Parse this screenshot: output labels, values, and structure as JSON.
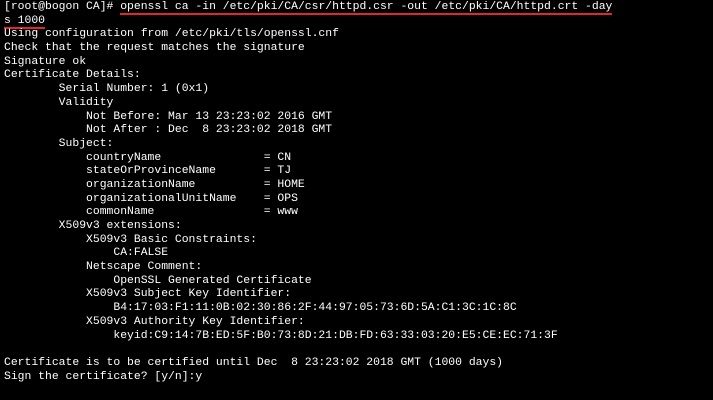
{
  "theme": {
    "background": "#000000",
    "foreground": "#ffffff",
    "highlight_underline": "#e3262c"
  },
  "prompt": "[root@bogon CA]# ",
  "command_part1": "openssl ca -in /etc/pki/CA/csr/httpd.csr -out /etc/pki/CA/httpd.crt -day",
  "command_part2": "s 1000",
  "output_lines": [
    "Using configuration from /etc/pki/tls/openssl.cnf",
    "Check that the request matches the signature",
    "Signature ok",
    "Certificate Details:",
    "        Serial Number: 1 (0x1)",
    "        Validity",
    "            Not Before: Mar 13 23:23:02 2016 GMT",
    "            Not After : Dec  8 23:23:02 2018 GMT",
    "        Subject:",
    "            countryName               = CN",
    "            stateOrProvinceName       = TJ",
    "            organizationName          = HOME",
    "            organizationalUnitName    = OPS",
    "            commonName                = www",
    "        X509v3 extensions:",
    "            X509v3 Basic Constraints:",
    "                CA:FALSE",
    "            Netscape Comment:",
    "                OpenSSL Generated Certificate",
    "            X509v3 Subject Key Identifier:",
    "                B4:17:03:F1:11:0B:02:30:86:2F:44:97:05:73:6D:5A:C1:3C:1C:8C",
    "            X509v3 Authority Key Identifier:",
    "                keyid:C9:14:7B:ED:5F:B0:73:8D:21:DB:FD:63:33:03:20:E5:CE:EC:71:3F",
    "",
    "Certificate is to be certified until Dec  8 23:23:02 2018 GMT (1000 days)"
  ],
  "final_prompt": "Sign the certificate? [y/n]:",
  "typed_input": "y"
}
